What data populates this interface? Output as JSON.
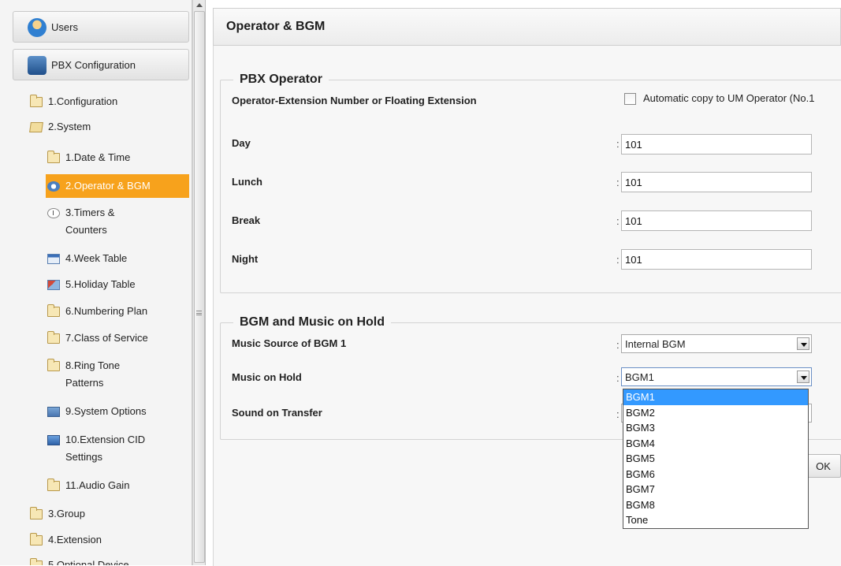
{
  "sidebar": {
    "users_label": "Users",
    "pbx_label": "PBX Configuration",
    "items": [
      {
        "label": "1.Configuration"
      },
      {
        "label": "2.System"
      },
      {
        "label": "1.Date & Time"
      },
      {
        "label": "2.Operator & BGM"
      },
      {
        "label": "3.Timers &"
      },
      {
        "label": "Counters"
      },
      {
        "label": "4.Week Table"
      },
      {
        "label": "5.Holiday Table"
      },
      {
        "label": "6.Numbering Plan"
      },
      {
        "label": "7.Class of Service"
      },
      {
        "label": "8.Ring Tone"
      },
      {
        "label": "Patterns"
      },
      {
        "label": "9.System Options"
      },
      {
        "label": "10.Extension CID"
      },
      {
        "label": "Settings"
      },
      {
        "label": "11.Audio Gain"
      },
      {
        "label": "3.Group"
      },
      {
        "label": "4.Extension"
      },
      {
        "label": "5.Optional Device"
      }
    ],
    "selected_item": "2.Operator & BGM",
    "accent_color": "#f7a21c"
  },
  "page": {
    "title": "Operator & BGM"
  },
  "operator": {
    "legend": "PBX Operator",
    "number_label": "Operator-Extension Number or Floating Extension",
    "auto_copy_label": "Automatic copy to UM Operator (No.1",
    "auto_copy_checked": false,
    "day_label": "Day",
    "day_value": "101",
    "lunch_label": "Lunch",
    "lunch_value": "101",
    "break_label": "Break",
    "break_value": "101",
    "night_label": "Night",
    "night_value": "101",
    "colon": ":"
  },
  "bgm": {
    "legend": "BGM and Music on Hold",
    "source_label": "Music Source of BGM 1",
    "source_value": "Internal BGM",
    "moh_label": "Music on Hold",
    "moh_value": "BGM1",
    "transfer_label": "Sound on Transfer",
    "options": [
      "BGM1",
      "BGM2",
      "BGM3",
      "BGM4",
      "BGM5",
      "BGM6",
      "BGM7",
      "BGM8",
      "Tone"
    ],
    "highlighted_option": "BGM1",
    "highlight_color": "#3399ff"
  },
  "actions": {
    "ok_label": "OK"
  }
}
